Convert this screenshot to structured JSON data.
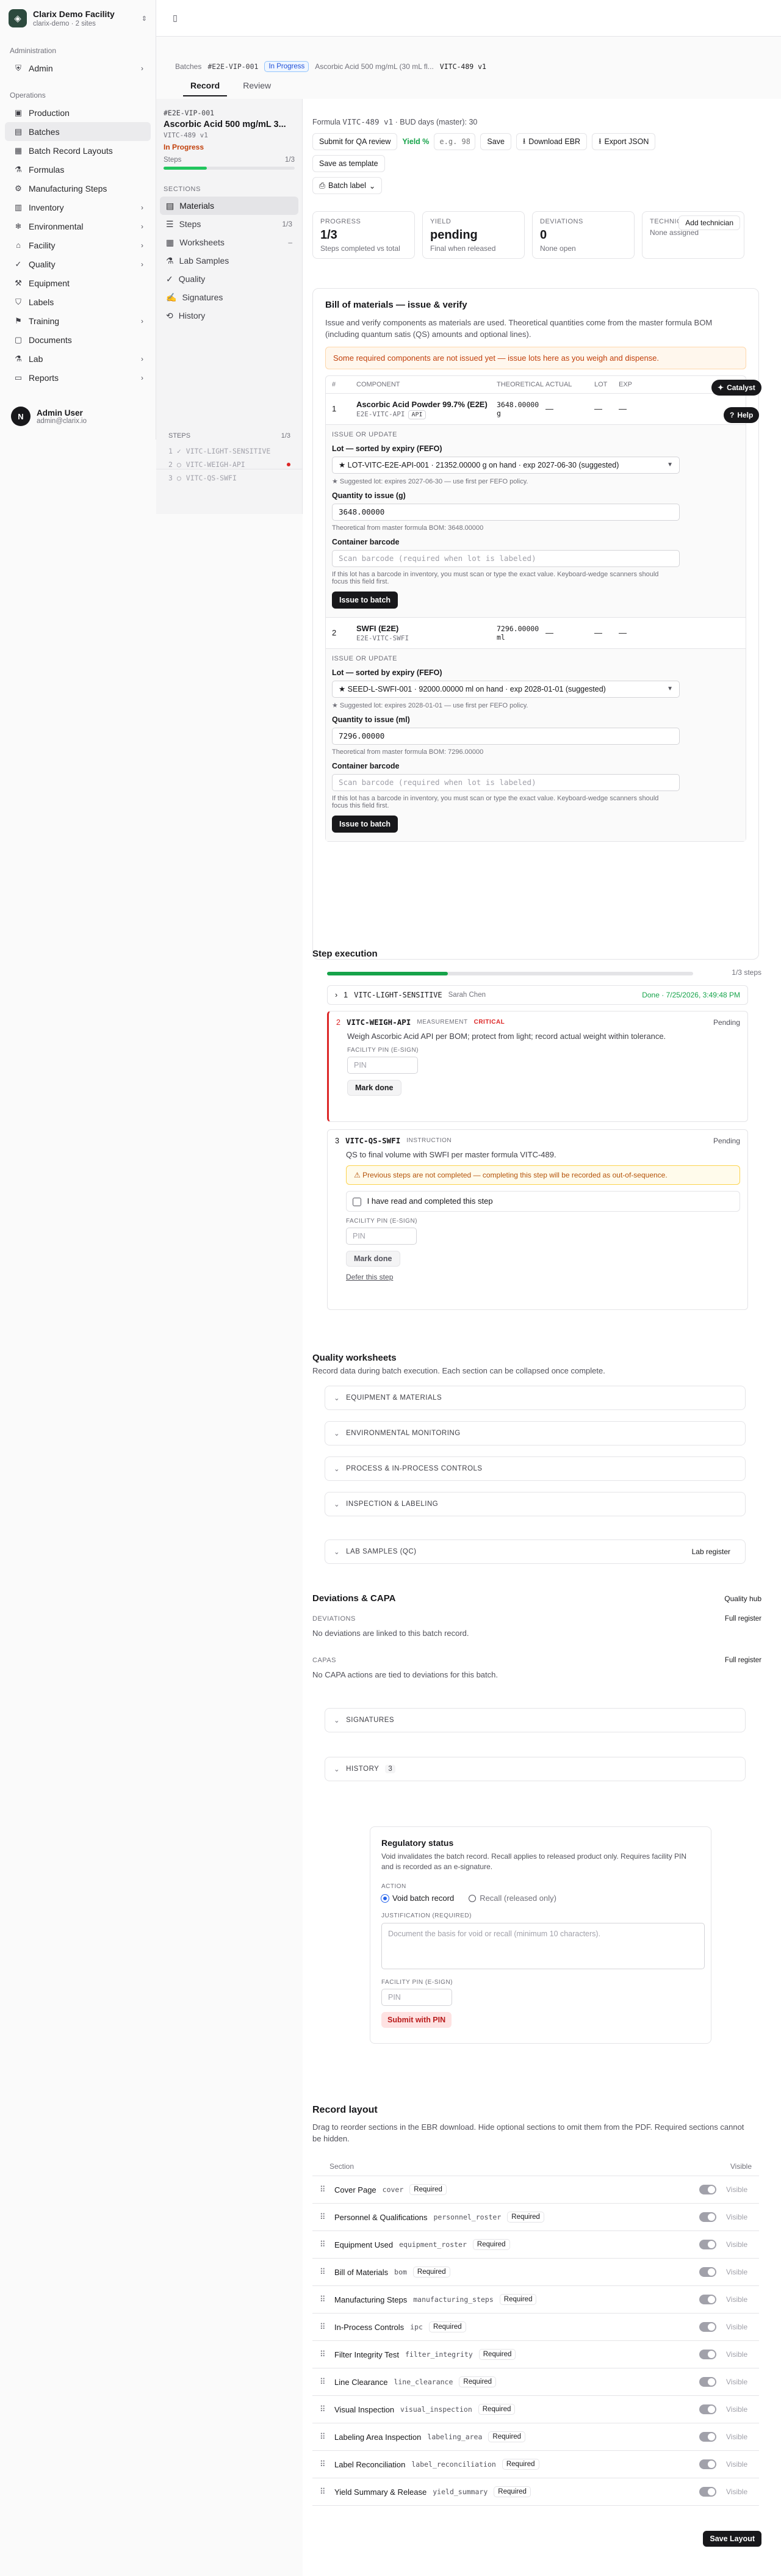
{
  "org": {
    "name": "Clarix Demo Facility",
    "sub": "clarix-demo · 2 sites"
  },
  "nav": {
    "admin_group": "Administration",
    "admin": "Admin",
    "ops_group": "Operations",
    "items": [
      "Production",
      "Batches",
      "Batch Record Layouts",
      "Formulas",
      "Manufacturing Steps",
      "Inventory",
      "Environmental",
      "Facility",
      "Quality",
      "Equipment",
      "Labels",
      "Training",
      "Documents",
      "Lab",
      "Reports"
    ]
  },
  "user": {
    "initial": "N",
    "name": "Admin User",
    "email": "admin@clarix.io"
  },
  "breadcrumbs": {
    "root": "Batches",
    "code": "#E2E-VIP-001",
    "status": "In Progress",
    "product": "Ascorbic Acid 500 mg/mL (30 mL fl...",
    "formula": "VITC-489 v1"
  },
  "tabs": {
    "record": "Record",
    "review": "Review"
  },
  "panel": {
    "code": "#E2E-VIP-001",
    "title": "Ascorbic Acid 500 mg/mL 3...",
    "formula": "VITC-489 v1",
    "status": "In Progress",
    "steps_label": "Steps",
    "steps_value": "1/3",
    "progress": 0.33,
    "sections_label": "SECTIONS",
    "sections": [
      {
        "label": "Materials",
        "count": ""
      },
      {
        "label": "Steps",
        "count": "1/3"
      },
      {
        "label": "Worksheets",
        "count": "–"
      },
      {
        "label": "Lab Samples",
        "count": ""
      },
      {
        "label": "Quality",
        "count": ""
      },
      {
        "label": "Signatures",
        "count": ""
      },
      {
        "label": "History",
        "count": ""
      }
    ],
    "steps_box_label": "STEPS",
    "steps_box_count": "1/3",
    "steps_list": [
      "VITC-LIGHT-SENSITIVE",
      "VITC-WEIGH-API",
      "VITC-QS-SWFI"
    ]
  },
  "main": {
    "formula_prefix": "Formula",
    "formula_code": "VITC-489 v1",
    "bud": "· BUD days (master): 30",
    "submit_qa": "Submit for QA review",
    "yield_label": "Yield %",
    "yield_placeholder": "e.g. 98",
    "save": "Save",
    "download_ebr": "Download EBR",
    "export_json": "Export JSON",
    "save_template": "Save as template",
    "batch_label": "Batch label",
    "stats": [
      {
        "label": "PROGRESS",
        "value": "1/3",
        "sub": "Steps completed vs total"
      },
      {
        "label": "YIELD",
        "value": "pending",
        "sub": "Final when released"
      },
      {
        "label": "DEVIATIONS",
        "value": "0",
        "sub": "None open"
      },
      {
        "label": "TECHNICIANS",
        "value": "",
        "sub": "None assigned"
      }
    ],
    "add_technician": "Add technician"
  },
  "bom": {
    "title": "Bill of materials — issue & verify",
    "desc": "Issue and verify components as materials are used. Theoretical quantities come from the master formula BOM (including quantum satis (QS) amounts and optional lines).",
    "warning": "Some required components are not issued yet — issue lots here as you weigh and dispense.",
    "cols": [
      "#",
      "COMPONENT",
      "THEORETICAL",
      "ACTUAL",
      "LOT",
      "EXP"
    ],
    "rows": [
      {
        "n": "1",
        "name": "Ascorbic Acid Powder 99.7% (E2E)",
        "code": "E2E-VITC-API",
        "api": "API",
        "theo": "3648.00000 g",
        "actual": "—",
        "lot": "—",
        "exp": "—",
        "issue_label": "ISSUE OR UPDATE",
        "lot_label": "Lot — sorted by expiry (FEFO)",
        "lot_value": "★ LOT-VITC-E2E-API-001 · 21352.00000 g on hand · exp 2027-06-30 (suggested)",
        "lot_hint": "★ Suggested lot: expires 2027-06-30 — use first per FEFO policy.",
        "qty_label": "Quantity to issue (g)",
        "qty_value": "3648.00000",
        "qty_hint": "Theoretical from master formula BOM: 3648.00000",
        "barcode_label": "Container barcode",
        "barcode_ph": "Scan barcode (required when lot is labeled)",
        "barcode_hint": "If this lot has a barcode in inventory, you must scan or type the exact value. Keyboard-wedge scanners should focus this field first.",
        "button": "Issue to batch"
      },
      {
        "n": "2",
        "name": "SWFI (E2E)",
        "code": "E2E-VITC-SWFI",
        "api": "",
        "theo": "7296.00000 ml",
        "actual": "—",
        "lot": "—",
        "exp": "—",
        "issue_label": "ISSUE OR UPDATE",
        "lot_label": "Lot — sorted by expiry (FEFO)",
        "lot_value": "★ SEED-L-SWFI-001 · 92000.00000 ml on hand · exp 2028-01-01 (suggested)",
        "lot_hint": "★ Suggested lot: expires 2028-01-01 — use first per FEFO policy.",
        "qty_label": "Quantity to issue (ml)",
        "qty_value": "7296.00000",
        "qty_hint": "Theoretical from master formula BOM: 7296.00000",
        "barcode_label": "Container barcode",
        "barcode_ph": "Scan barcode (required when lot is labeled)",
        "barcode_hint": "If this lot has a barcode in inventory, you must scan or type the exact value. Keyboard-wedge scanners should focus this field first.",
        "button": "Issue to batch"
      }
    ]
  },
  "steps": {
    "title": "Step execution",
    "count": "1/3 steps",
    "progress": 0.33,
    "s1": {
      "n": "1",
      "code": "VITC-LIGHT-SENSITIVE",
      "who": "Sarah Chen",
      "status": "Done · 7/25/2026, 3:49:48 PM"
    },
    "s2": {
      "n": "2",
      "code": "VITC-WEIGH-API",
      "type": "MEASUREMENT",
      "crit": "CRITICAL",
      "status": "Pending",
      "desc": "Weigh Ascorbic Acid API per BOM; protect from light; record actual weight within tolerance.",
      "pin_label": "FACILITY PIN (E-SIGN)",
      "pin_ph": "PIN",
      "button": "Mark done"
    },
    "s3": {
      "n": "3",
      "code": "VITC-QS-SWFI",
      "type": "INSTRUCTION",
      "status": "Pending",
      "desc": "QS to final volume with SWFI per master formula VITC-489.",
      "warn": "⚠ Previous steps are not completed — completing this step will be recorded as out-of-sequence.",
      "confirm": "I have read and completed this step",
      "pin_label": "FACILITY PIN (E-SIGN)",
      "pin_ph": "PIN",
      "button": "Mark done",
      "defer": "Defer this step"
    }
  },
  "worksheets": {
    "title": "Quality worksheets",
    "desc": "Record data during batch execution. Each section can be collapsed once complete.",
    "sections": [
      "EQUIPMENT & MATERIALS",
      "ENVIRONMENTAL MONITORING",
      "PROCESS & IN-PROCESS CONTROLS",
      "INSPECTION & LABELING"
    ]
  },
  "lab": {
    "label": "LAB SAMPLES (QC)",
    "link": "Lab register"
  },
  "deviations": {
    "title": "Deviations & CAPA",
    "hub": "Quality hub",
    "dev_label": "DEVIATIONS",
    "dev_link": "Full register",
    "dev_text": "No deviations are linked to this batch record.",
    "capa_label": "CAPAS",
    "capa_link": "Full register",
    "capa_text": "No CAPA actions are tied to deviations for this batch."
  },
  "signatures": {
    "label": "SIGNATURES"
  },
  "history": {
    "label": "HISTORY",
    "count": "3"
  },
  "regulatory": {
    "title": "Regulatory status",
    "desc": "Void invalidates the batch record. Recall applies to released product only. Requires facility PIN and is recorded as an e-signature.",
    "action_label": "ACTION",
    "opt1": "Void batch record",
    "opt2": "Recall (released only)",
    "just_label": "JUSTIFICATION (REQUIRED)",
    "just_ph": "Document the basis for void or recall (minimum 10 characters).",
    "pin_label": "FACILITY PIN (E-SIGN)",
    "pin_ph": "PIN",
    "button": "Submit with PIN"
  },
  "layout": {
    "title": "Record layout",
    "desc": "Drag to reorder sections in the EBR download. Hide optional sections to omit them from the PDF. Required sections cannot be hidden.",
    "col_section": "Section",
    "col_visible": "Visible",
    "required": "Required",
    "visible": "Visible",
    "rows": [
      {
        "name": "Cover Page",
        "key": "cover"
      },
      {
        "name": "Personnel & Qualifications",
        "key": "personnel_roster"
      },
      {
        "name": "Equipment Used",
        "key": "equipment_roster"
      },
      {
        "name": "Bill of Materials",
        "key": "bom"
      },
      {
        "name": "Manufacturing Steps",
        "key": "manufacturing_steps"
      },
      {
        "name": "In-Process Controls",
        "key": "ipc"
      },
      {
        "name": "Filter Integrity Test",
        "key": "filter_integrity"
      },
      {
        "name": "Line Clearance",
        "key": "line_clearance"
      },
      {
        "name": "Visual Inspection",
        "key": "visual_inspection"
      },
      {
        "name": "Labeling Area Inspection",
        "key": "labeling_area"
      },
      {
        "name": "Label Reconciliation",
        "key": "label_reconciliation"
      },
      {
        "name": "Yield Summary & Release",
        "key": "yield_summary"
      }
    ],
    "save": "Save Layout"
  },
  "floating": {
    "catalyst": "Catalyst",
    "help": "Help"
  }
}
